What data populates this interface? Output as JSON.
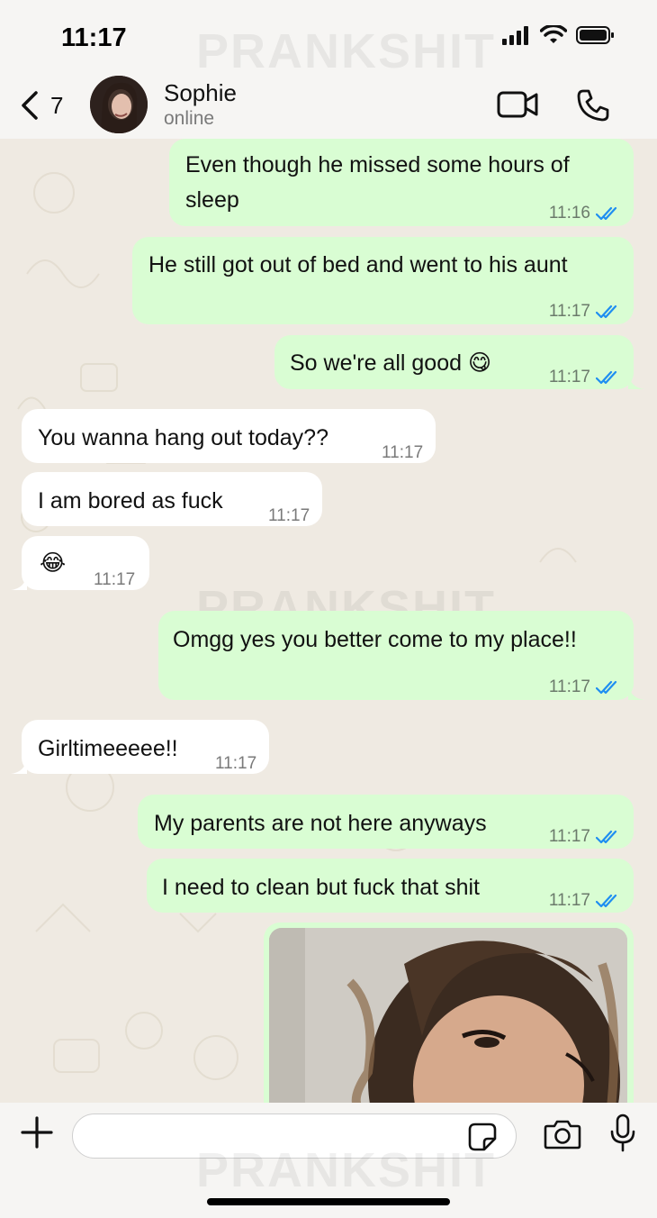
{
  "status_bar": {
    "time": "11:17",
    "watermark": "PRANKSHIT"
  },
  "header": {
    "back_count": "7",
    "contact_name": "Sophie",
    "contact_status": "online"
  },
  "messages": [
    {
      "direction": "out",
      "text_lines": [
        "Even though he missed some hours of",
        "sleep"
      ],
      "time": "11:16",
      "read": true
    },
    {
      "direction": "out",
      "text_lines": [
        "He still got out of bed and went to his aunt"
      ],
      "time": "11:17",
      "read": true
    },
    {
      "direction": "out",
      "text_lines": [
        "So we're all good 😋"
      ],
      "time": "11:17",
      "read": true
    },
    {
      "direction": "in",
      "text_lines": [
        "You wanna hang out today??"
      ],
      "time": "11:17"
    },
    {
      "direction": "in",
      "text_lines": [
        "I am bored as fuck"
      ],
      "time": "11:17"
    },
    {
      "direction": "in",
      "text_lines": [
        "😂"
      ],
      "time": "11:17"
    },
    {
      "direction": "out",
      "text_lines": [
        "Omgg yes you better come to my place!!"
      ],
      "time": "11:17",
      "read": true
    },
    {
      "direction": "in",
      "text_lines": [
        "Girltimeeeee!!"
      ],
      "time": "11:17"
    },
    {
      "direction": "out",
      "text_lines": [
        "My parents are not here anyways"
      ],
      "time": "11:17",
      "read": true
    },
    {
      "direction": "out",
      "text_lines": [
        "I need to clean but fuck that shit"
      ],
      "time": "11:17",
      "read": true
    }
  ],
  "input": {
    "placeholder": "",
    "value": ""
  },
  "colors": {
    "outgoing_bubble": "#d9fdd3",
    "incoming_bubble": "#ffffff",
    "read_tick": "#1f8ef1",
    "chat_background": "#efeae2"
  }
}
